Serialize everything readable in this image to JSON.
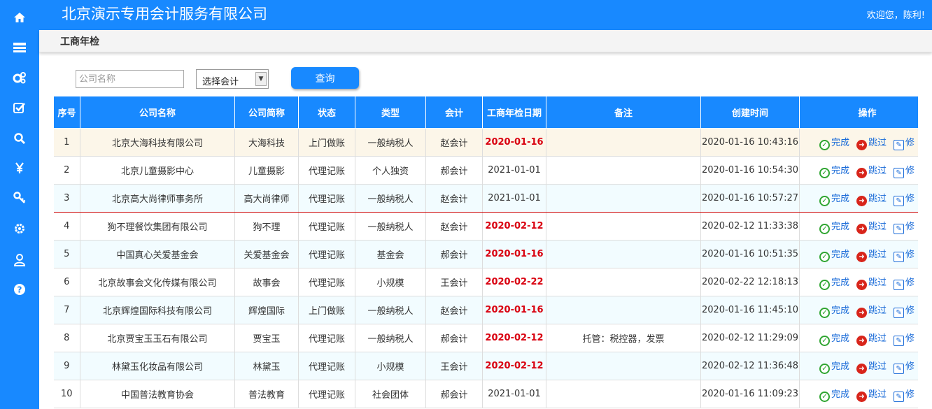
{
  "app": {
    "title": "北京演示专用会计服务有限公司",
    "welcome": "欢迎您，陈利!"
  },
  "sidebar": {
    "icons": [
      "home-icon",
      "list-icon",
      "cogs-icon",
      "checkbox-icon",
      "search-icon",
      "yen-icon",
      "key-icon",
      "gear-icon",
      "user-icon",
      "help-icon"
    ]
  },
  "breadcrumb": "工商年检",
  "filters": {
    "company_placeholder": "公司名称",
    "accountant_selected": "选择会计",
    "query_label": "查询"
  },
  "table": {
    "headers": [
      "序号",
      "公司名称",
      "公司简称",
      "状态",
      "类型",
      "会计",
      "工商年检日期",
      "备注",
      "创建时间",
      "操作"
    ],
    "rows": [
      {
        "no": "1",
        "name": "北京大海科技有限公司",
        "short": "大海科技",
        "status": "上门做账",
        "type": "一般纳税人",
        "acct": "赵会计",
        "date": "2020-01-16",
        "overdue": true,
        "note": "",
        "created": "2020-01-16 10:43:16"
      },
      {
        "no": "2",
        "name": "北京儿童摄影中心",
        "short": "儿童摄影",
        "status": "代理记账",
        "type": "个人独资",
        "acct": "郝会计",
        "date": "2021-01-01",
        "overdue": false,
        "note": "",
        "created": "2020-01-16 10:54:30"
      },
      {
        "no": "3",
        "name": "北京高大尚律师事务所",
        "short": "高大尚律师",
        "status": "代理记账",
        "type": "一般纳税人",
        "acct": "赵会计",
        "date": "2021-01-01",
        "overdue": false,
        "note": "",
        "created": "2020-01-16 10:57:27"
      },
      {
        "no": "4",
        "name": "狗不理餐饮集团有限公司",
        "short": "狗不理",
        "status": "代理记账",
        "type": "一般纳税人",
        "acct": "赵会计",
        "date": "2020-02-12",
        "overdue": true,
        "note": "",
        "created": "2020-02-12 11:33:38"
      },
      {
        "no": "5",
        "name": "中国真心关爱基金会",
        "short": "关爱基金会",
        "status": "代理记账",
        "type": "基金会",
        "acct": "郝会计",
        "date": "2020-01-16",
        "overdue": true,
        "note": "",
        "created": "2020-01-16 10:51:35"
      },
      {
        "no": "6",
        "name": "北京故事会文化传媒有限公司",
        "short": "故事会",
        "status": "代理记账",
        "type": "小规模",
        "acct": "王会计",
        "date": "2020-02-22",
        "overdue": true,
        "note": "",
        "created": "2020-02-22 12:18:13"
      },
      {
        "no": "7",
        "name": "北京辉煌国际科技有限公司",
        "short": "辉煌国际",
        "status": "上门做账",
        "type": "一般纳税人",
        "acct": "赵会计",
        "date": "2020-01-16",
        "overdue": true,
        "note": "",
        "created": "2020-01-16 11:45:10"
      },
      {
        "no": "8",
        "name": "北京贾宝玉玉石有限公司",
        "short": "贾宝玉",
        "status": "代理记账",
        "type": "一般纳税人",
        "acct": "郝会计",
        "date": "2020-02-12",
        "overdue": true,
        "note": "托管：税控器，发票",
        "created": "2020-02-12 11:29:09"
      },
      {
        "no": "9",
        "name": "林黛玉化妆品有限公司",
        "short": "林黛玉",
        "status": "代理记账",
        "type": "小规模",
        "acct": "王会计",
        "date": "2020-02-12",
        "overdue": true,
        "note": "",
        "created": "2020-02-12 11:36:48"
      },
      {
        "no": "10",
        "name": "中国普法教育协会",
        "short": "普法教育",
        "status": "代理记账",
        "type": "社会团体",
        "acct": "郝会计",
        "date": "2021-01-01",
        "overdue": false,
        "note": "",
        "created": "2020-01-16 11:09:23"
      }
    ],
    "actions": {
      "complete": "完成",
      "skip": "跳过",
      "edit": "修"
    }
  },
  "colors": {
    "primary": "#1889ff",
    "overdue": "#d9000f",
    "row_alt": "#f2fcff",
    "row_highlight": "#fcf6e9"
  }
}
